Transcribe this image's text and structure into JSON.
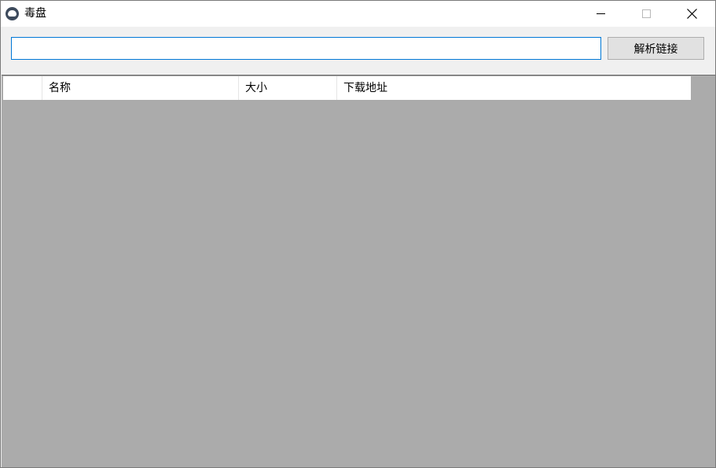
{
  "window": {
    "title": "毒盘",
    "icon": "cloud-icon",
    "controls": {
      "minimize": "minimize-icon",
      "maximize": "maximize-icon",
      "close": "close-icon"
    }
  },
  "toolbar": {
    "url_input_value": "",
    "url_input_placeholder": "",
    "parse_button_label": "解析链接"
  },
  "table": {
    "columns": [
      "",
      "名称",
      "大小",
      "下载地址"
    ],
    "rows": []
  },
  "colors": {
    "title_bar": "#ffffff",
    "window_bg": "#f0f0f0",
    "grid_bg": "#ababab",
    "input_focus_border": "#0078d7",
    "button_bg": "#e1e1e1"
  }
}
